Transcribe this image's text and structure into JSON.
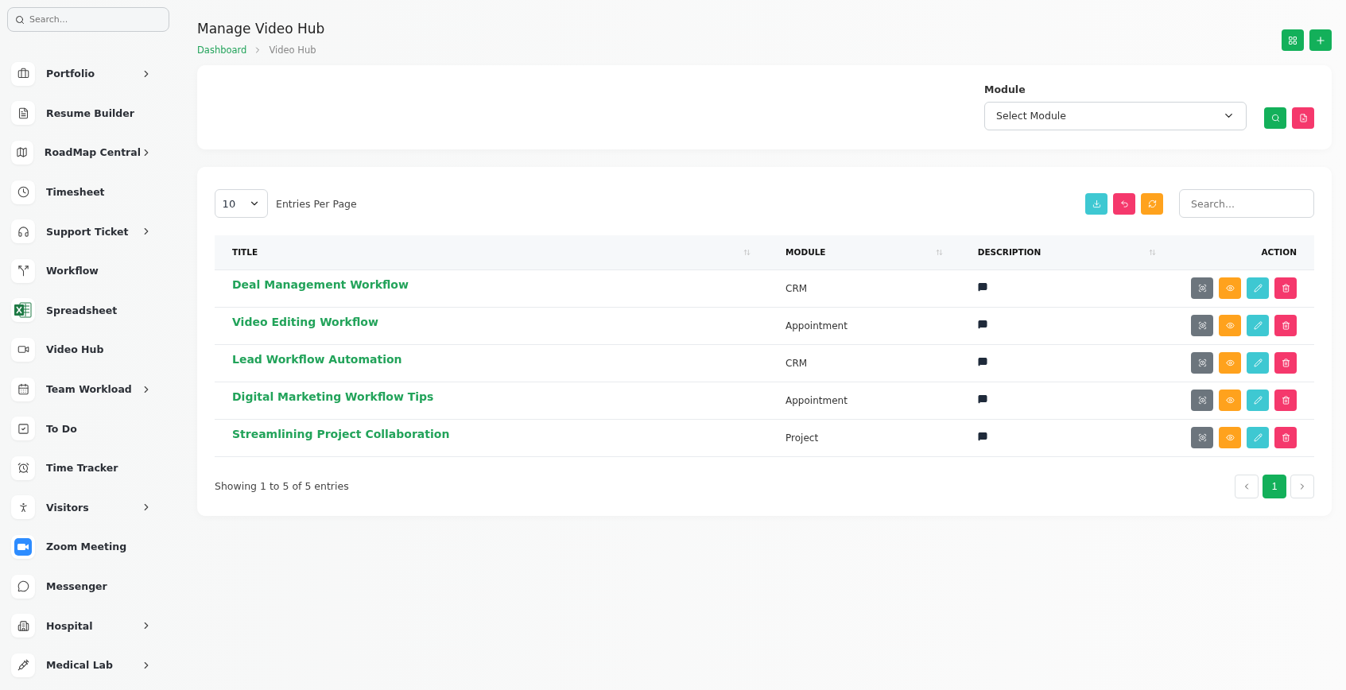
{
  "sidebar": {
    "search": {
      "placeholder": "Search..."
    },
    "items": [
      {
        "label": "Portfolio",
        "has_submenu": true
      },
      {
        "label": "Resume Builder",
        "has_submenu": false
      },
      {
        "label": "RoadMap Central",
        "has_submenu": true
      },
      {
        "label": "Timesheet",
        "has_submenu": false
      },
      {
        "label": "Support Ticket",
        "has_submenu": true
      },
      {
        "label": "Workflow",
        "has_submenu": false
      },
      {
        "label": "Spreadsheet",
        "has_submenu": false
      },
      {
        "label": "Video Hub",
        "has_submenu": false
      },
      {
        "label": "Team Workload",
        "has_submenu": true
      },
      {
        "label": "To Do",
        "has_submenu": false
      },
      {
        "label": "Time Tracker",
        "has_submenu": false
      },
      {
        "label": "Visitors",
        "has_submenu": true
      },
      {
        "label": "Zoom Meeting",
        "has_submenu": false
      },
      {
        "label": "Messenger",
        "has_submenu": false
      },
      {
        "label": "Hospital",
        "has_submenu": true
      },
      {
        "label": "Medical Lab",
        "has_submenu": true
      }
    ]
  },
  "header": {
    "title": "Manage Video Hub",
    "breadcrumb": [
      "Dashboard",
      "Video Hub"
    ]
  },
  "filter": {
    "label": "Module",
    "placeholder": "Select Module"
  },
  "table_controls": {
    "per_page": "10",
    "per_page_label": "Entries Per Page",
    "search_placeholder": "Search..."
  },
  "table": {
    "columns": [
      "TITLE",
      "MODULE",
      "DESCRIPTION",
      "ACTION"
    ],
    "rows": [
      {
        "title": "Deal Management Workflow",
        "module": "CRM"
      },
      {
        "title": "Video Editing Workflow",
        "module": "Appointment"
      },
      {
        "title": "Lead Workflow Automation",
        "module": "CRM"
      },
      {
        "title": "Digital Marketing Workflow Tips",
        "module": "Appointment"
      },
      {
        "title": "Streamlining Project Collaboration",
        "module": "Project"
      }
    ]
  },
  "footer": {
    "summary": "Showing 1 to 5 of 5 entries",
    "pages": [
      {
        "label": "1",
        "selected": true
      }
    ]
  }
}
